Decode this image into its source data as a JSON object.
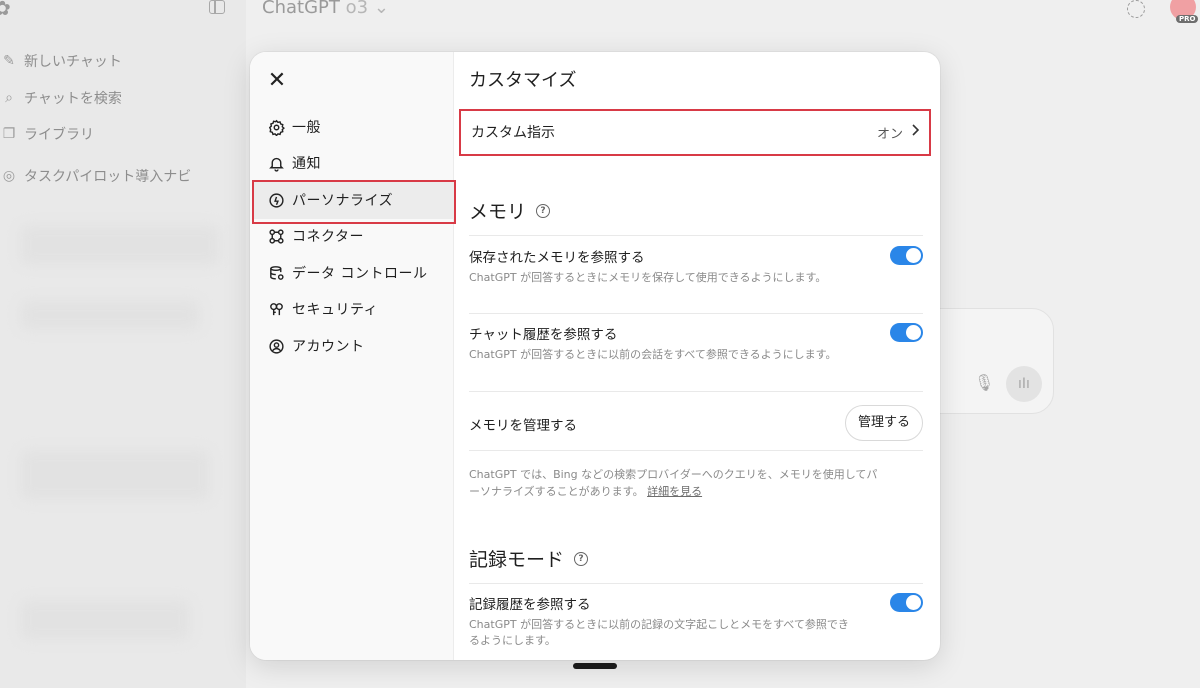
{
  "background": {
    "app_title": "ChatGPT",
    "model_name": "o3",
    "badge": "PRO",
    "sidebar_items": [
      {
        "label": "新しいチャット",
        "icon": "edit-icon"
      },
      {
        "label": "チャットを検索",
        "icon": "search-icon"
      },
      {
        "label": "ライブラリ",
        "icon": "library-icon"
      },
      {
        "label": "タスクパイロット導入ナビ",
        "icon": "gpt-icon"
      }
    ]
  },
  "settings": {
    "nav": [
      {
        "label": "一般",
        "icon": "gear-icon"
      },
      {
        "label": "通知",
        "icon": "bell-icon"
      },
      {
        "label": "パーソナライズ",
        "icon": "personalize-icon",
        "active": true
      },
      {
        "label": "コネクター",
        "icon": "connector-icon"
      },
      {
        "label": "データ コントロール",
        "icon": "database-icon"
      },
      {
        "label": "セキュリティ",
        "icon": "security-icon"
      },
      {
        "label": "アカウント",
        "icon": "account-icon"
      }
    ],
    "title": "カスタマイズ",
    "custom_instructions": {
      "label": "カスタム指示",
      "value": "オン"
    },
    "memory": {
      "heading": "メモリ",
      "saved_memory": {
        "title": "保存されたメモリを参照する",
        "desc": "ChatGPT が回答するときにメモリを保存して使用できるようにします。",
        "enabled": true
      },
      "chat_history": {
        "title": "チャット履歴を参照する",
        "desc": "ChatGPT が回答するときに以前の会話をすべて参照できるようにします。",
        "enabled": true
      },
      "manage": {
        "title": "メモリを管理する",
        "button": "管理する"
      },
      "note": "ChatGPT では、Bing などの検索プロバイダーへのクエリを、メモリを使用してパーソナライズすることがあります。",
      "note_link": "詳細を見る"
    },
    "record_mode": {
      "heading": "記録モード",
      "record_history": {
        "title": "記録履歴を参照する",
        "desc": "ChatGPT が回答するときに以前の記録の文字起こしとメモをすべて参照できるようにします。",
        "enabled": true
      }
    }
  },
  "colors": {
    "accent_toggle": "#2a86e8",
    "highlight_box": "#d83a46"
  }
}
